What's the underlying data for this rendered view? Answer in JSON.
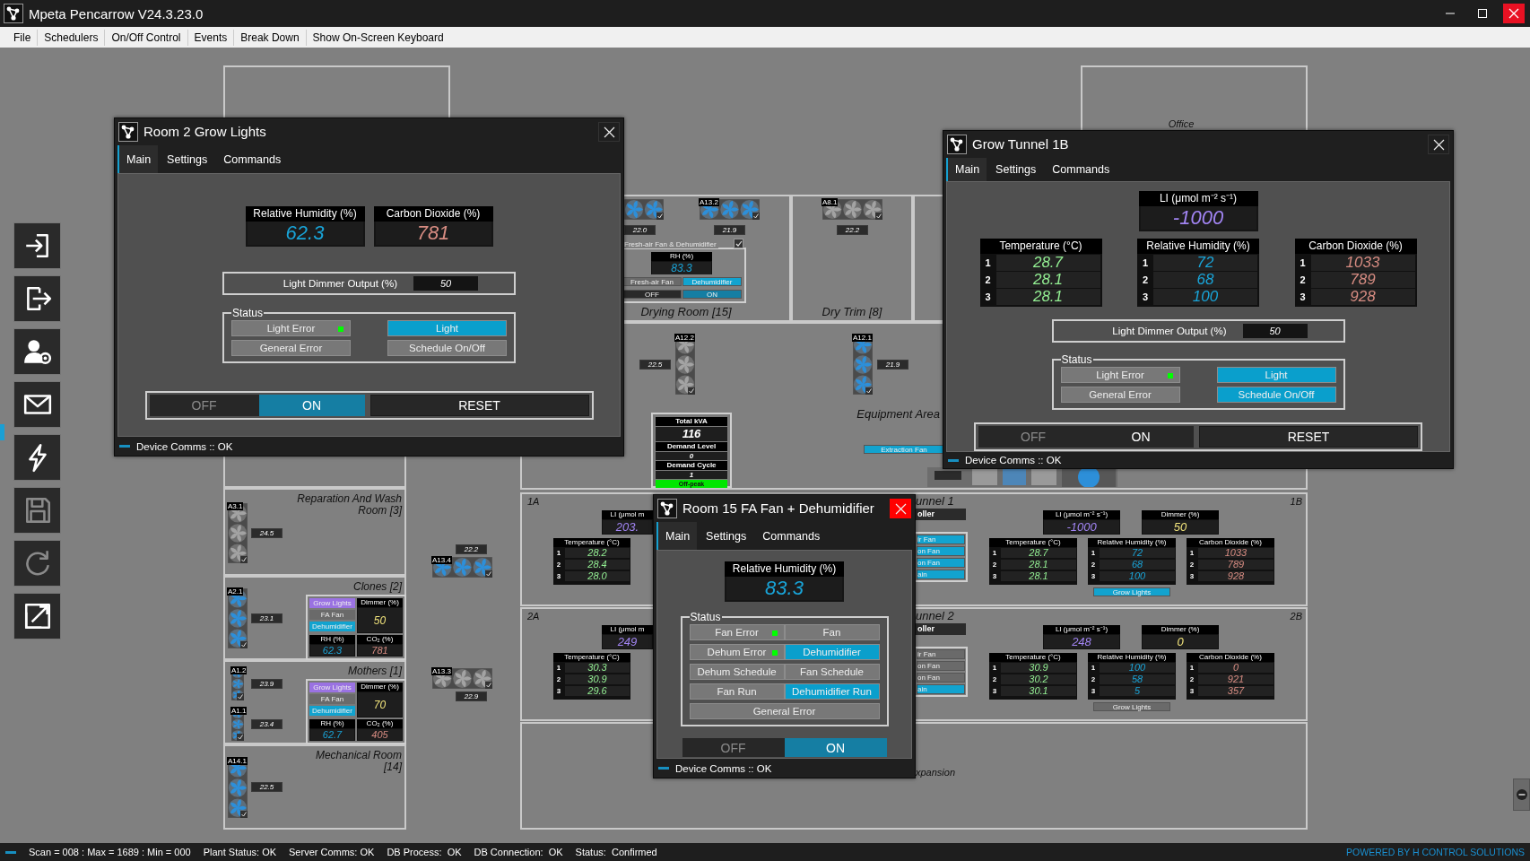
{
  "window": {
    "title": "Mpeta Pencarrow V24.3.23.0"
  },
  "menu": [
    "File",
    "Schedulers",
    "On/Off Control",
    "Events",
    "Break Down",
    "Show On-Screen Keyboard"
  ],
  "toolbar": [
    {
      "kind": "login",
      "disabled": false
    },
    {
      "kind": "logout",
      "disabled": false
    },
    {
      "kind": "user-settings",
      "disabled": false
    },
    {
      "kind": "mail",
      "disabled": false
    },
    {
      "kind": "power",
      "disabled": false
    },
    {
      "kind": "save",
      "disabled": true
    },
    {
      "kind": "refresh",
      "disabled": true
    },
    {
      "kind": "expand",
      "disabled": false
    }
  ],
  "floor_plan": {
    "rooms": [
      {
        "name": "Office"
      },
      {
        "name": "Drying Room [15]"
      },
      {
        "name": "Dry Trim [8]"
      },
      {
        "name": "Equipment Area"
      },
      {
        "name": "Reparation And Wash Room [3]"
      },
      {
        "name": "Clones [2]"
      },
      {
        "name": "Mothers [1]"
      },
      {
        "name": "Mechanical Room [14]"
      },
      {
        "name": "unnel 1"
      },
      {
        "name": "unnel 2"
      },
      {
        "name": "xpansion"
      }
    ],
    "fans": [
      {
        "on": true,
        "reading": "22.0"
      },
      {
        "tag": "A13.2",
        "on": true,
        "reading": "21.9"
      },
      {
        "tag": "A8.1",
        "on": false,
        "reading": "22.2"
      },
      {
        "tag": "A12.2",
        "on": false,
        "reading": "22.5"
      },
      {
        "tag": "A12.1",
        "on": true,
        "reading": "21.9"
      },
      {
        "tag": "A13.4",
        "on": true,
        "reading": "22.2"
      },
      {
        "tag": "A13.3",
        "on": false,
        "reading": "22.9"
      },
      {
        "tag": "A3.1",
        "on": false,
        "reading": "24.5"
      },
      {
        "tag": "A2.1",
        "on": true,
        "reading": "23.1"
      },
      {
        "tag": "A1.2",
        "on": true,
        "reading": "23.9"
      },
      {
        "tag": "A1.1",
        "on": true,
        "reading": "23.4"
      },
      {
        "tag": "A14.1",
        "on": true,
        "reading": "22.5"
      }
    ],
    "room_panels": [
      {
        "buttons": [
          {
            "label": "Grow Lights",
            "kind": "lights",
            "on": true
          },
          {
            "label": "FA Fan",
            "kind": "fan",
            "on": false
          },
          {
            "label": "Dehumidifier",
            "kind": "dehumidifier",
            "on": true
          }
        ],
        "readouts": [
          {
            "label": "Dimmer (%)",
            "value": "50",
            "kind": "dimmer"
          },
          {
            "label": "RH (%)",
            "value": "62.3",
            "kind": "humidity"
          },
          {
            "label": "CO₂ (%)",
            "value": "781",
            "kind": "co2"
          }
        ]
      },
      {
        "buttons": [
          {
            "label": "Grow Lights",
            "kind": "lights",
            "on": true
          },
          {
            "label": "FA Fan",
            "kind": "fan",
            "on": false
          },
          {
            "label": "Dehumidifier",
            "kind": "dehumidifier",
            "on": true
          }
        ],
        "readouts": [
          {
            "label": "Dimmer (%)",
            "value": "70",
            "kind": "dimmer"
          },
          {
            "label": "RH (%)",
            "value": "62.7",
            "kind": "humidity"
          },
          {
            "label": "CO₂ (%)",
            "value": "405",
            "kind": "co2"
          }
        ]
      }
    ],
    "drying_panel": {
      "title": "Fresh-air Fan & Dehumidifier",
      "checked": true,
      "readout": {
        "label": "RH (%)",
        "value": "83.3",
        "kind": "humidity"
      },
      "buttons": [
        {
          "label": "Fresh-air Fan",
          "on": false
        },
        {
          "label": "Dehumidifier",
          "on": true
        }
      ],
      "switch": [
        {
          "label": "OFF",
          "selected": false
        },
        {
          "label": "ON",
          "selected": true
        }
      ]
    },
    "power_panel": {
      "rows": [
        {
          "label": "Total kVA",
          "value": "116"
        },
        {
          "label": "Demand Level",
          "value": "0"
        },
        {
          "label": "Demand Cycle",
          "value": "1"
        }
      ],
      "tariff": "Off-peak"
    },
    "extraction_fan": {
      "label": "Extraction Fan",
      "on": true
    },
    "tunnels": [
      {
        "label_a": "1A",
        "label_b": "1B",
        "controller": "oller",
        "buttons": [
          {
            "label": "ir Fan",
            "on": true
          },
          {
            "label": "on Fan",
            "on": true
          },
          {
            "label": "on Fan",
            "on": true
          },
          {
            "label": "ain",
            "on": true
          }
        ],
        "a": {
          "li": {
            "label": "LI (μmol m",
            "value": "203."
          },
          "temperature": {
            "label": "Temperature (°C)",
            "rows": [
              {
                "n": "1",
                "value": "28.2"
              },
              {
                "n": "2",
                "value": "28.4"
              },
              {
                "n": "3",
                "value": "28.0"
              }
            ]
          }
        },
        "b": {
          "li": {
            "label": "LI (μmol m⁻² s⁻¹)",
            "value": "-1000"
          },
          "dimmer": {
            "label": "Dimmer (%)",
            "value": "50"
          },
          "tiles": [
            {
              "kind": "temperature",
              "label": "Temperature (°C)",
              "rows": [
                {
                  "n": "1",
                  "value": "28.7"
                },
                {
                  "n": "2",
                  "value": "28.1"
                },
                {
                  "n": "3",
                  "value": "28.1"
                }
              ]
            },
            {
              "kind": "humidity",
              "label": "Relative Humidity (%)",
              "rows": [
                {
                  "n": "1",
                  "value": "72"
                },
                {
                  "n": "2",
                  "value": "68"
                },
                {
                  "n": "3",
                  "value": "100"
                }
              ]
            },
            {
              "kind": "co2",
              "label": "Carbon Dioxide (%)",
              "rows": [
                {
                  "n": "1",
                  "value": "1033"
                },
                {
                  "n": "2",
                  "value": "789"
                },
                {
                  "n": "3",
                  "value": "928"
                }
              ]
            }
          ],
          "grow_lights": {
            "label": "Grow Lights",
            "on": true
          }
        }
      },
      {
        "label_a": "2A",
        "label_b": "2B",
        "controller": "oller",
        "buttons": [
          {
            "label": "ir Fan",
            "on": false
          },
          {
            "label": "on Fan",
            "on": false
          },
          {
            "label": "on Fan",
            "on": false
          },
          {
            "label": "ain",
            "on": true
          }
        ],
        "a": {
          "li": {
            "label": "LI (μmol m",
            "value": "249"
          },
          "temperature": {
            "label": "Temperature (°C)",
            "rows": [
              {
                "n": "1",
                "value": "30.3"
              },
              {
                "n": "2",
                "value": "30.9"
              },
              {
                "n": "3",
                "value": "29.6"
              }
            ]
          }
        },
        "b": {
          "li": {
            "label": "LI (μmol m⁻² s⁻¹)",
            "value": "248"
          },
          "dimmer": {
            "label": "Dimmer (%)",
            "value": "0"
          },
          "tiles": [
            {
              "kind": "temperature",
              "label": "Temperature (°C)",
              "rows": [
                {
                  "n": "1",
                  "value": "30.9"
                },
                {
                  "n": "2",
                  "value": "30.2"
                },
                {
                  "n": "3",
                  "value": "30.1"
                }
              ]
            },
            {
              "kind": "humidity",
              "label": "Relative Humidity (%)",
              "rows": [
                {
                  "n": "1",
                  "value": "100"
                },
                {
                  "n": "2",
                  "value": "58"
                },
                {
                  "n": "3",
                  "value": "5"
                }
              ]
            },
            {
              "kind": "co2",
              "label": "Carbon Dioxide (%)",
              "rows": [
                {
                  "n": "1",
                  "value": "0"
                },
                {
                  "n": "2",
                  "value": "921"
                },
                {
                  "n": "3",
                  "value": "357"
                }
              ]
            }
          ],
          "grow_lights": {
            "label": "Grow Lights",
            "on": false
          }
        }
      }
    ]
  },
  "dialogs": [
    {
      "title": "Room 2 Grow Lights",
      "close_highlighted": false,
      "tabs": [
        {
          "label": "Main",
          "selected": true
        },
        {
          "label": "Settings",
          "selected": false
        },
        {
          "label": "Commands",
          "selected": false
        }
      ],
      "readouts": [
        {
          "kind": "humidity",
          "label": "Relative Humidity (%)",
          "value": "62.3"
        },
        {
          "kind": "co2",
          "label": "Carbon Dioxide (%)",
          "value": "781"
        }
      ],
      "dimmer": {
        "label": "Light Dimmer Output (%)",
        "value": "50"
      },
      "status": {
        "title": "Status",
        "items": [
          {
            "label": "Light Error",
            "on": false,
            "lamp": true,
            "wide": false
          },
          {
            "label": "Light",
            "on": true,
            "lamp": false,
            "wide": false
          },
          {
            "label": "General Error",
            "on": false,
            "lamp": false,
            "wide": false
          },
          {
            "label": "Schedule On/Off",
            "on": false,
            "lamp": false,
            "wide": false
          }
        ]
      },
      "switch": [
        {
          "label": "OFF",
          "selected": false,
          "disabled": true
        },
        {
          "label": "ON",
          "selected": true,
          "disabled": false
        }
      ],
      "reset": "RESET",
      "footer": "Device Comms :: OK"
    },
    {
      "title": "Grow Tunnel 1B",
      "close_highlighted": false,
      "tabs": [
        {
          "label": "Main",
          "selected": true
        },
        {
          "label": "Settings",
          "selected": false
        },
        {
          "label": "Commands",
          "selected": false
        }
      ],
      "readouts": [
        {
          "kind": "light",
          "label": "LI (μmol m⁻² s⁻¹)",
          "value": "-1000"
        },
        {
          "kind": "temperature",
          "label": "Temperature (°C)",
          "rows": [
            {
              "n": "1",
              "value": "28.7"
            },
            {
              "n": "2",
              "value": "28.1"
            },
            {
              "n": "3",
              "value": "28.1"
            }
          ]
        },
        {
          "kind": "humidity",
          "label": "Relative Humidity (%)",
          "rows": [
            {
              "n": "1",
              "value": "72"
            },
            {
              "n": "2",
              "value": "68"
            },
            {
              "n": "3",
              "value": "100"
            }
          ]
        },
        {
          "kind": "co2",
          "label": "Carbon Dioxide (%)",
          "rows": [
            {
              "n": "1",
              "value": "1033"
            },
            {
              "n": "2",
              "value": "789"
            },
            {
              "n": "3",
              "value": "928"
            }
          ]
        }
      ],
      "dimmer": {
        "label": "Light Dimmer Output (%)",
        "value": "50"
      },
      "status": {
        "title": "Status",
        "items": [
          {
            "label": "Light Error",
            "on": false,
            "lamp": true,
            "wide": false
          },
          {
            "label": "Light",
            "on": true,
            "lamp": false,
            "wide": false
          },
          {
            "label": "General Error",
            "on": false,
            "lamp": false,
            "wide": false
          },
          {
            "label": "Schedule On/Off",
            "on": true,
            "lamp": false,
            "wide": false
          }
        ]
      },
      "switch": [
        {
          "label": "OFF",
          "selected": false,
          "disabled": true
        },
        {
          "label": "ON",
          "selected": false,
          "disabled": false
        }
      ],
      "reset": "RESET",
      "footer": "Device Comms :: OK"
    },
    {
      "title": "Room 15 FA Fan + Dehumidifier",
      "close_highlighted": true,
      "tabs": [
        {
          "label": "Main",
          "selected": true
        },
        {
          "label": "Settings",
          "selected": false
        },
        {
          "label": "Commands",
          "selected": false
        }
      ],
      "readouts": [
        {
          "kind": "humidity",
          "label": "Relative Humidity (%)",
          "value": "83.3"
        }
      ],
      "status": {
        "title": "Status",
        "items": [
          {
            "label": "Fan Error",
            "on": false,
            "lamp": true,
            "wide": false
          },
          {
            "label": "Fan",
            "on": false,
            "lamp": false,
            "wide": false
          },
          {
            "label": "Dehum Error",
            "on": false,
            "lamp": true,
            "wide": false
          },
          {
            "label": "Dehumidifier",
            "on": true,
            "lamp": false,
            "wide": false
          },
          {
            "label": "Dehum Schedule",
            "on": false,
            "lamp": false,
            "wide": false
          },
          {
            "label": "Fan Schedule",
            "on": false,
            "lamp": false,
            "wide": false
          },
          {
            "label": "Fan Run",
            "on": false,
            "lamp": false,
            "wide": false
          },
          {
            "label": "Dehumidifier Run",
            "on": true,
            "lamp": false,
            "wide": false
          },
          {
            "label": "General Error",
            "on": false,
            "lamp": false,
            "wide": true
          }
        ]
      },
      "switch": [
        {
          "label": "OFF",
          "selected": false,
          "disabled": true
        },
        {
          "label": "ON",
          "selected": true,
          "disabled": false
        }
      ],
      "footer": "Device Comms :: OK"
    }
  ],
  "status_bar": {
    "items": [
      "Scan = 008 : Max = 1689 : Min = 000",
      "Plant Status: OK",
      "Server Comms: OK",
      "DB Process:  OK",
      "DB Connection:  OK",
      "Status:  Confirmed"
    ],
    "brand": "POWERED BY H CONTROL SOLUTIONS"
  }
}
